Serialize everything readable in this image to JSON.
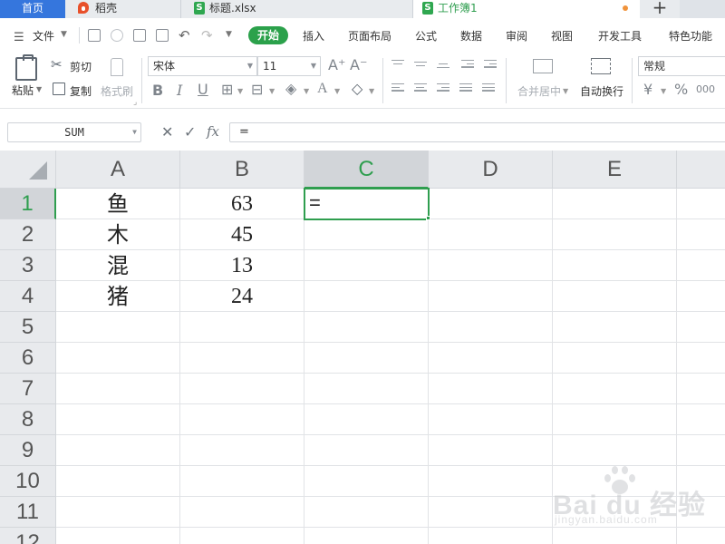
{
  "tabs": {
    "home": "首页",
    "docer": "稻壳",
    "file1": "标题.xlsx",
    "active": "工作簿1",
    "new_tab": "+",
    "file_icon_letter": "S"
  },
  "menu": {
    "file": "文件",
    "start": "开始",
    "items": [
      "插入",
      "页面布局",
      "公式",
      "数据",
      "审阅",
      "视图",
      "开发工具",
      "特色功能"
    ]
  },
  "ribbon": {
    "paste": "粘贴",
    "cut": "剪切",
    "copy": "复制",
    "format_painter": "格式刷",
    "font_name": "宋体",
    "font_size": "11",
    "merge_center": "合并居中",
    "wrap_text": "自动换行",
    "number_format": "常规",
    "currency_glyph": "¥",
    "percent_glyph": "%",
    "comma_glyph": "000"
  },
  "formula_bar": {
    "name_box": "SUM",
    "cancel": "✕",
    "confirm": "✓",
    "fx": "fx",
    "content": "="
  },
  "sheet": {
    "columns": [
      "A",
      "B",
      "C",
      "D",
      "E"
    ],
    "rows": [
      "1",
      "2",
      "3",
      "4",
      "5",
      "6",
      "7",
      "8",
      "9",
      "10",
      "11",
      "12"
    ],
    "data": [
      {
        "a": "鱼",
        "b": "63"
      },
      {
        "a": "木",
        "b": "45"
      },
      {
        "a": "混",
        "b": "13"
      },
      {
        "a": "猪",
        "b": "24"
      }
    ],
    "active_cell": "=",
    "selected_column": "C",
    "selected_row": "1"
  },
  "watermark": {
    "main": "Bai du 经验",
    "sub": "jingyan.baidu.com"
  },
  "colors": {
    "accent_green": "#2f9e4f",
    "home_tab_blue": "#3576dd"
  }
}
